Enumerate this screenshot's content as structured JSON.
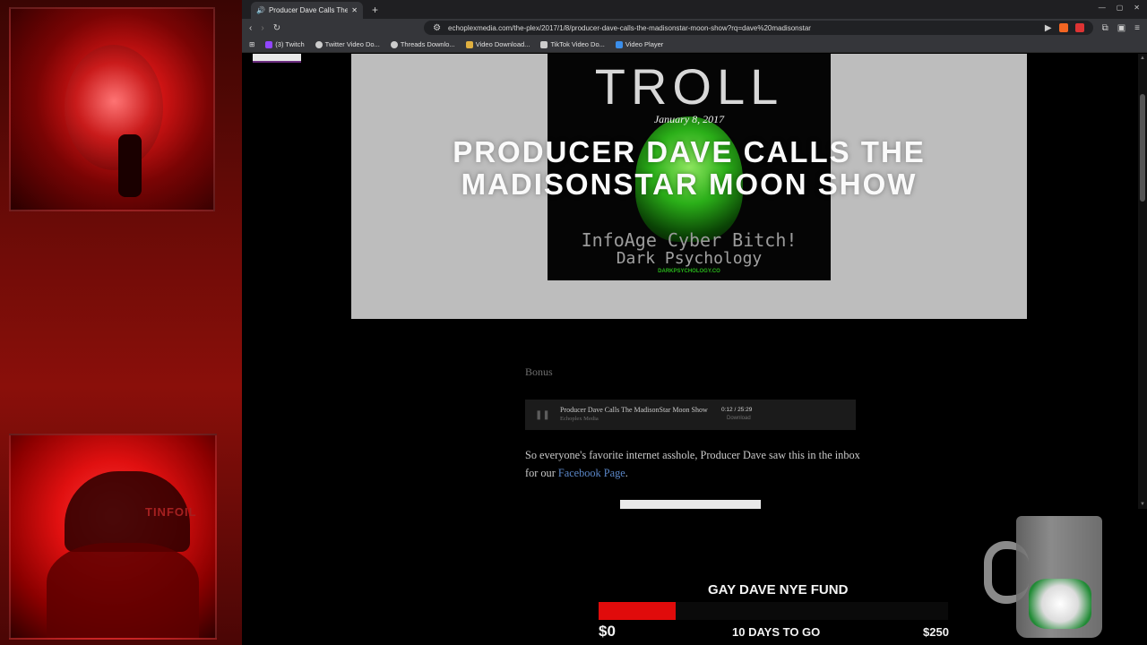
{
  "browser": {
    "tab_title": "Producer Dave Calls The",
    "new_tab": "+",
    "url": "echoplexmedia.com/the-plex/2017/1/8/producer-dave-calls-the-madisonstar-moon-show?rq=dave%20madisonstar",
    "bookmarks": [
      {
        "label": "(3) Twitch",
        "color": "#9146ff"
      },
      {
        "label": "Twitter Video Do...",
        "color": "#cccccc"
      },
      {
        "label": "Threads Downlo...",
        "color": "#cccccc"
      },
      {
        "label": "Video Download...",
        "color": "#e0b040"
      },
      {
        "label": "TikTok Video Do...",
        "color": "#cccccc"
      },
      {
        "label": "Video Player",
        "color": "#3b8eea"
      }
    ]
  },
  "post": {
    "image_title": "TROLL",
    "image_line1": "InfoAge Cyber Bitch!",
    "image_line2": "Dark Psychology",
    "image_site": "DARKPSYCHOLOGY.CO",
    "date": "January 8, 2017",
    "title": "PRODUCER DAVE CALLS THE MADISONSTAR MOON SHOW",
    "bonus_label": "Bonus",
    "player": {
      "track": "Producer Dave Calls The MadisonStar Moon Show",
      "artist": "Echoplex Media",
      "time": "0:12 / 25:29",
      "download": "Download",
      "progress": 0.008
    },
    "body_text": "So everyone's favorite internet asshole, Producer Dave saw this in the inbox for our ",
    "body_link": "Facebook Page",
    "body_end": "."
  },
  "overlay": {
    "cam_cap_text": "TINFOIL",
    "fund_title": "GAY DAVE NYE FUND",
    "fund_min": "$0",
    "fund_days": "10 DAYS TO GO",
    "fund_max": "$250",
    "fund_progress": 0.22,
    "accent": "#e00b0b"
  }
}
